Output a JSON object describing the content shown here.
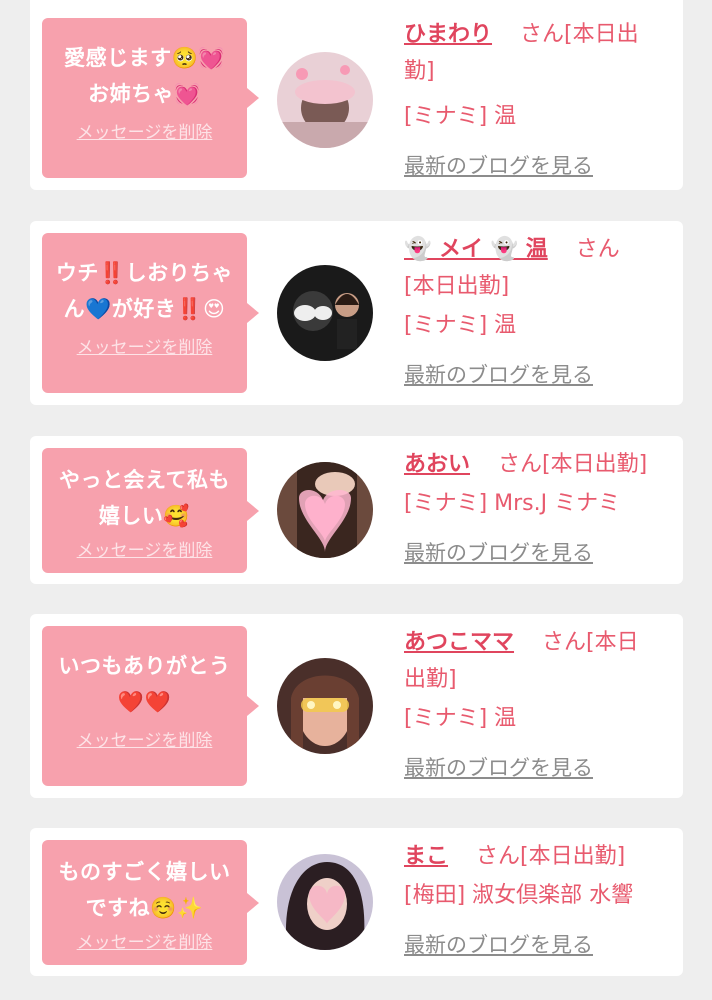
{
  "messages": [
    {
      "bubble_line1": "愛感じます🥺💓",
      "bubble_line2": "お姉ちゃ💓",
      "delete_label": "メッセージを削除",
      "name": "ひまわり",
      "suffix": "さん[本日出",
      "suffix2": "勤]",
      "shop": "[ミナミ] 温",
      "blog_label": "最新のブログを見る"
    },
    {
      "bubble_line1": "ウチ‼️しおりちゃ",
      "bubble_line2": "ん💙が好き‼️😍",
      "delete_label": "メッセージを削除",
      "name": "👻 メイ 👻 温",
      "suffix": "さん",
      "suffix2": "[本日出勤]",
      "shop": "[ミナミ] 温",
      "blog_label": "最新のブログを見る"
    },
    {
      "bubble_line1": "やっと会えて私も",
      "bubble_line2": "嬉しい🥰",
      "delete_label": "メッセージを削除",
      "name": "あおい",
      "suffix": "さん[本日出勤]",
      "suffix2": "",
      "shop": "[ミナミ] Mrs.J ミナミ",
      "blog_label": "最新のブログを見る"
    },
    {
      "bubble_line1": "いつもありがとう",
      "bubble_line2": "❤️❤️",
      "delete_label": "メッセージを削除",
      "name": "あつこママ",
      "suffix": "さん[本日",
      "suffix2": "出勤]",
      "shop": "[ミナミ] 温",
      "blog_label": "最新のブログを見る"
    },
    {
      "bubble_line1": "ものすごく嬉しい",
      "bubble_line2": "ですね☺️✨",
      "delete_label": "メッセージを削除",
      "name": "まこ",
      "suffix": "さん[本日出勤]",
      "suffix2": "",
      "shop": "[梅田] 淑女倶楽部 水響",
      "blog_label": "最新のブログを見る"
    }
  ],
  "colors": {
    "bubble": "#f7a1ad",
    "name": "#e0455e",
    "text": "#e85a6e",
    "link_gray": "#8c8c8c"
  }
}
